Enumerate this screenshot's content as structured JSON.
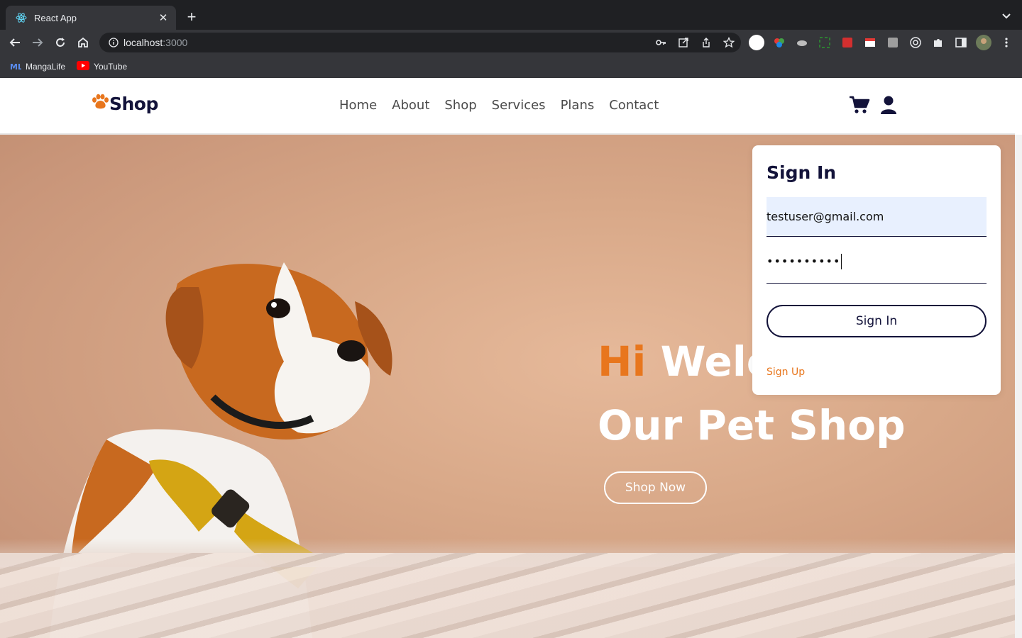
{
  "browser": {
    "tab_title": "React App",
    "url_host": "localhost",
    "url_port": ":3000",
    "bookmarks": [
      {
        "label": "MangaLife",
        "icon": "mangalife-icon"
      },
      {
        "label": "YouTube",
        "icon": "youtube-icon"
      }
    ]
  },
  "site": {
    "logo_text": "Shop",
    "nav": [
      "Home",
      "About",
      "Shop",
      "Services",
      "Plans",
      "Contact"
    ]
  },
  "hero": {
    "headline_hi": "Hi",
    "headline_rest": "Welc",
    "headline_line2": "Our Pet Shop",
    "cta_label": "Shop Now"
  },
  "signin": {
    "title": "Sign In",
    "email_value": "testuser@gmail.com",
    "password_masked": "••••••••••",
    "button_label": "Sign In",
    "signup_link": "Sign Up"
  },
  "colors": {
    "accent": "#e8761d",
    "navy": "#13133a",
    "hero_bg": "#d8a888"
  }
}
